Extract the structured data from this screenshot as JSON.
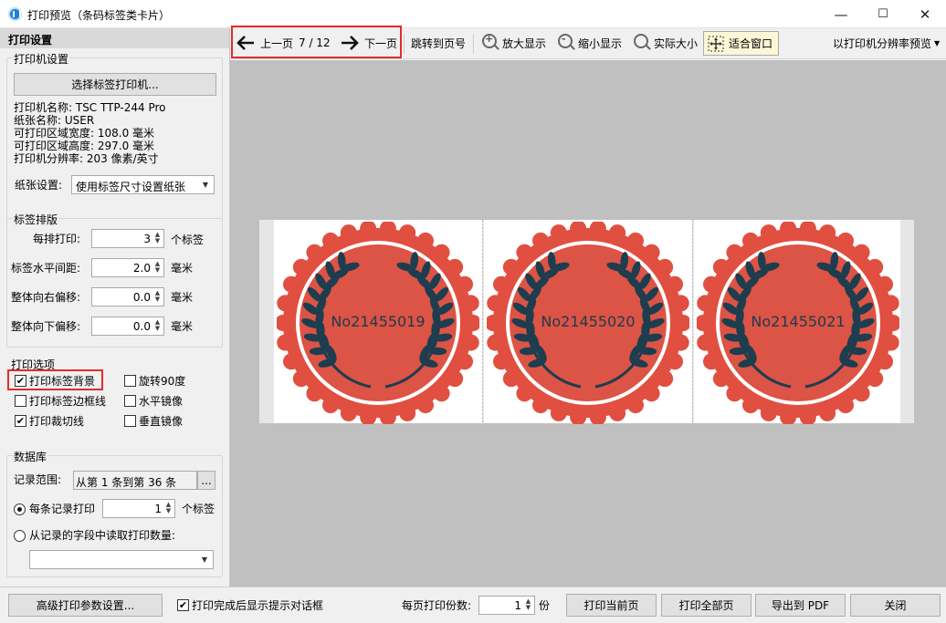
{
  "window": {
    "title": "打印预览（条码标签类卡片）",
    "minimize": "—",
    "maximize": "☐",
    "close": "✕"
  },
  "left_panel": {
    "header": "打印设置",
    "printer_group": {
      "title": "打印机设置",
      "select_button": "选择标签打印机...",
      "info": [
        "打印机名称: TSC TTP-244 Pro",
        "纸张名称: USER",
        "可打印区域宽度: 108.0 毫米",
        "可打印区域高度: 297.0 毫米",
        "打印机分辨率: 203 像素/英寸"
      ],
      "paper_label": "纸张设置:",
      "paper_value": "使用标签尺寸设置纸张"
    },
    "layout_group": {
      "title": "标签排版",
      "rows": [
        {
          "label": "每排打印:",
          "value": "3",
          "unit": "个标签"
        },
        {
          "label": "标签水平间距:",
          "value": "2.0",
          "unit": "毫米"
        },
        {
          "label": "整体向右偏移:",
          "value": "0.0",
          "unit": "毫米"
        },
        {
          "label": "整体向下偏移:",
          "value": "0.0",
          "unit": "毫米"
        }
      ]
    },
    "options_group": {
      "title": "打印选项",
      "options": [
        {
          "label": "打印标签背景",
          "checked": true
        },
        {
          "label": "旋转90度",
          "checked": false
        },
        {
          "label": "打印标签边框线",
          "checked": false
        },
        {
          "label": "水平镜像",
          "checked": false
        },
        {
          "label": "打印裁切线",
          "checked": true
        },
        {
          "label": "垂直镜像",
          "checked": false
        }
      ]
    },
    "database_group": {
      "title": "数据库",
      "range_label": "记录范围:",
      "range_value": "从第 1 条到第 36 条",
      "range_button": "...",
      "per_record_label": "每条记录打印",
      "per_record_value": "1",
      "per_record_unit": "个标签",
      "from_field_label": "从记录的字段中读取打印数量:",
      "from_field_value": ""
    }
  },
  "toolbar": {
    "prev": "上一页",
    "page": "7 / 12",
    "next": "下一页",
    "jump": "跳转到页号",
    "zoom_in": "放大显示",
    "zoom_out": "缩小显示",
    "actual": "实际大小",
    "fit": "适合窗口",
    "mode": "以打印机分辨率预览"
  },
  "preview": {
    "labels": [
      "No21455019",
      "No21455020",
      "No21455021"
    ],
    "colors": {
      "badge": "#e14f41",
      "badge_inner": "#dc5445",
      "laurel": "#1e3d4f",
      "ring": "#ffffff",
      "canvas": "#c0c0c0"
    }
  },
  "bottom": {
    "advanced": "高级打印参数设置...",
    "show_dialog_label": "打印完成后显示提示对话框",
    "show_dialog_checked": true,
    "copies_label": "每页打印份数:",
    "copies_value": "1",
    "copies_unit": "份",
    "print_current": "打印当前页",
    "print_all": "打印全部页",
    "export_pdf": "导出到 PDF",
    "close": "关闭"
  }
}
